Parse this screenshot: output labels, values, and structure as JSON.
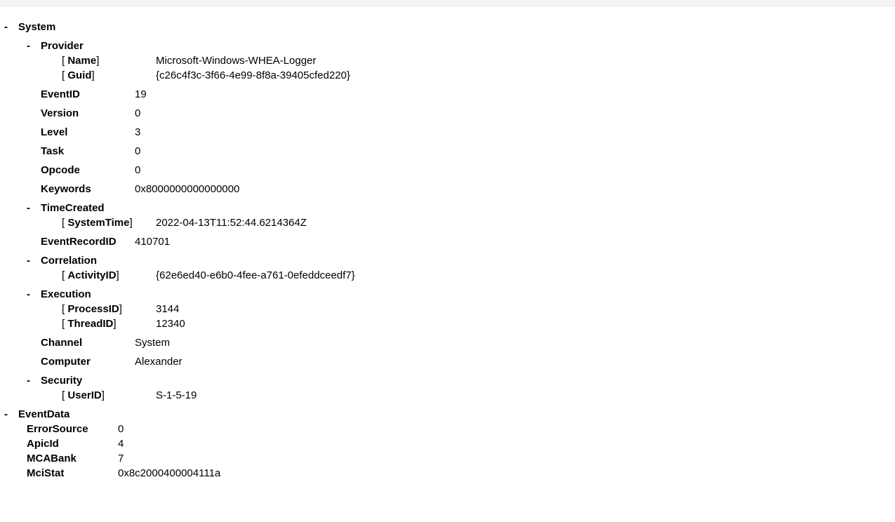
{
  "system": {
    "label": "System",
    "provider": {
      "label": "Provider",
      "name_label": "Name",
      "name_value": "Microsoft-Windows-WHEA-Logger",
      "guid_label": "Guid",
      "guid_value": "{c26c4f3c-3f66-4e99-8f8a-39405cfed220}"
    },
    "eventId": {
      "label": "EventID",
      "value": "19"
    },
    "version": {
      "label": "Version",
      "value": "0"
    },
    "level": {
      "label": "Level",
      "value": "3"
    },
    "task": {
      "label": "Task",
      "value": "0"
    },
    "opcode": {
      "label": "Opcode",
      "value": "0"
    },
    "keywords": {
      "label": "Keywords",
      "value": "0x8000000000000000"
    },
    "timeCreated": {
      "label": "TimeCreated",
      "systemTime_label": "SystemTime",
      "systemTime_value": "2022-04-13T11:52:44.6214364Z"
    },
    "eventRecordId": {
      "label": "EventRecordID",
      "value": "410701"
    },
    "correlation": {
      "label": "Correlation",
      "activityId_label": "ActivityID",
      "activityId_value": "{62e6ed40-e6b0-4fee-a761-0efeddceedf7}"
    },
    "execution": {
      "label": "Execution",
      "processId_label": "ProcessID",
      "processId_value": "3144",
      "threadId_label": "ThreadID",
      "threadId_value": "12340"
    },
    "channel": {
      "label": "Channel",
      "value": "System"
    },
    "computer": {
      "label": "Computer",
      "value": "Alexander"
    },
    "security": {
      "label": "Security",
      "userId_label": "UserID",
      "userId_value": "S-1-5-19"
    }
  },
  "eventData": {
    "label": "EventData",
    "errorSource": {
      "label": "ErrorSource",
      "value": "0"
    },
    "apicId": {
      "label": "ApicId",
      "value": "4"
    },
    "mcaBank": {
      "label": "MCABank",
      "value": "7"
    },
    "mciStat": {
      "label": "MciStat",
      "value": "0x8c2000400004111a"
    }
  }
}
